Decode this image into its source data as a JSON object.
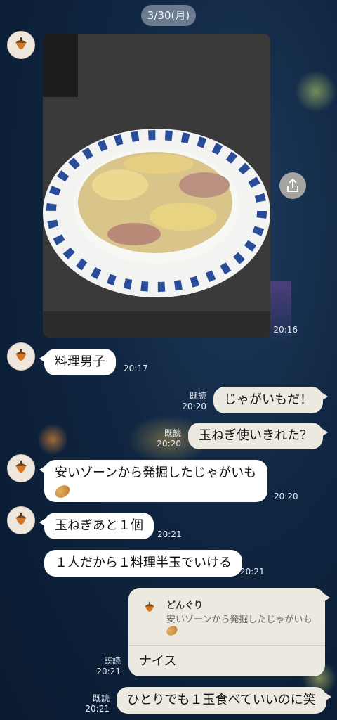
{
  "date_separator": "3/30(月)",
  "messages": {
    "m1": {
      "time": "20:16"
    },
    "m2": {
      "text": "料理男子",
      "time": "20:17"
    },
    "m3": {
      "text": "じゃがいもだ！",
      "read": "既読",
      "time": "20:20"
    },
    "m4": {
      "text": "玉ねぎ使いきれた？",
      "read": "既読",
      "time": "20:20"
    },
    "m5": {
      "text": "安いゾーンから発掘したじゃがいも",
      "time": "20:20"
    },
    "m6": {
      "text": "玉ねぎあと１個",
      "time": "20:21"
    },
    "m7": {
      "text": "１人だから１料理半玉でいける",
      "time": "20:21"
    },
    "m8": {
      "reply_name": "どんぐり",
      "reply_text": "安いゾーンから発掘したじゃがいも",
      "text": "ナイス",
      "read": "既読",
      "time": "20:21"
    },
    "m9": {
      "text": "ひとりでも１玉食べていいのに笑",
      "read": "既読",
      "time": "20:21"
    }
  },
  "icons": {
    "avatar": "acorn-icon",
    "share": "share-icon",
    "emoji": "potato-emoji"
  },
  "colors": {
    "incoming_bubble": "#ffffff",
    "outgoing_bubble": "#ece9e0",
    "background": "#0f2540"
  }
}
